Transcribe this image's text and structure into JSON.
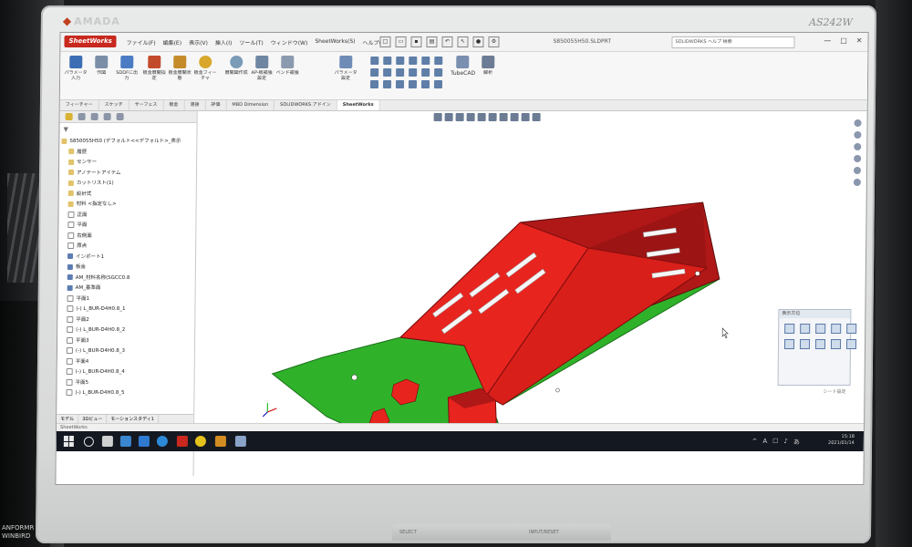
{
  "monitor": {
    "brand": "AMADA",
    "model": "AS242W",
    "osd_buttons": [
      "SELECT",
      "INPUT/RESET"
    ]
  },
  "side_device_label": "ANFORMR\nWINBIRD",
  "app": {
    "logo": "SheetWorks",
    "menus": [
      "ファイル(F)",
      "編集(E)",
      "表示(V)",
      "挿入(I)",
      "ツール(T)",
      "ウィンドウ(W)",
      "SheetWorks(S)",
      "ヘルプ(H)"
    ],
    "filename": "S850055H50.SLDPRT",
    "search_placeholder": "SOLIDWORKS ヘルプ 検索",
    "window_controls": [
      "—",
      "□",
      "✕"
    ]
  },
  "ribbon": {
    "buttons": [
      {
        "label": "パラメータ入力",
        "color": "#3b6db4"
      },
      {
        "label": "作図",
        "color": "#7b8ea7"
      },
      {
        "label": "SDDFに出力",
        "color": "#4c7cc4"
      },
      {
        "label": "板金展開指定",
        "color": "#c34b2d"
      },
      {
        "label": "板金展開状態",
        "color": "#c58b2b"
      },
      {
        "label": "板金フィーチャ",
        "color": "#d8a72c"
      },
      {
        "label": "展開図作成",
        "color": "#7b9bb7"
      },
      {
        "label": "AP-板補強設定",
        "color": "#6f86a3"
      },
      {
        "label": "ベンド補強",
        "color": "#8c9ab0"
      }
    ],
    "extras": [
      {
        "label": "パラメータ設定",
        "color": "#6f8cb7"
      },
      {
        "label": "TubeCAD",
        "color": "#7a8fb0"
      },
      {
        "label": "解析",
        "color": "#6b7c94"
      }
    ]
  },
  "tabs": [
    "フィーチャー",
    "スケッチ",
    "サーフェス",
    "板金",
    "溶接",
    "評価",
    "MBD Dimension",
    "SOLIDWORKS アドイン",
    "SheetWorks"
  ],
  "active_tab": "SheetWorks",
  "tree": {
    "filter_icon": "filter-icon",
    "root": "S850055H50 (デフォルト<<デフォルト>_表示",
    "items": [
      {
        "label": "履歴",
        "icon": "folder"
      },
      {
        "label": "センサー",
        "icon": "folder"
      },
      {
        "label": "アノテートアイテム",
        "icon": "folder"
      },
      {
        "label": "カットリスト(1)",
        "icon": "folder"
      },
      {
        "label": "設計式",
        "icon": "folder"
      },
      {
        "label": "材料 <指定なし>",
        "icon": "folder"
      },
      {
        "label": "正面",
        "icon": "plane"
      },
      {
        "label": "平面",
        "icon": "plane"
      },
      {
        "label": "右側面",
        "icon": "plane"
      },
      {
        "label": "原点",
        "icon": "plane"
      },
      {
        "label": "インポート1",
        "icon": "sheet"
      },
      {
        "label": "板金",
        "icon": "sheet"
      },
      {
        "label": "AM_材料名称(SGCC0.8",
        "icon": "sheet"
      },
      {
        "label": "AM_基準面",
        "icon": "sheet"
      },
      {
        "label": "平面1",
        "icon": "plane"
      },
      {
        "label": "(-) L_BUR-D4H0.8_1",
        "icon": "plane"
      },
      {
        "label": "平面2",
        "icon": "plane"
      },
      {
        "label": "(-) L_BUR-D4H0.8_2",
        "icon": "plane"
      },
      {
        "label": "平面3",
        "icon": "plane"
      },
      {
        "label": "(-) L_BUR-D4H0.8_3",
        "icon": "plane"
      },
      {
        "label": "平面4",
        "icon": "plane"
      },
      {
        "label": "(-) L_BUR-D4H0.8_4",
        "icon": "plane"
      },
      {
        "label": "平面5",
        "icon": "plane"
      },
      {
        "label": "(-) L_BUR-D4H0.8_5",
        "icon": "plane"
      }
    ],
    "bottom_tabs": [
      "モデル",
      "3Dビュー",
      "モーションスタディ1"
    ]
  },
  "status_bar": "SheetWorks",
  "taskpane": {
    "title": "表示方位",
    "view_label": "シート設定"
  },
  "model_colors": {
    "red": "#e8241f",
    "dark_red": "#b01818",
    "green": "#2fb22a",
    "light_green": "#53cc3d"
  },
  "taskbar": {
    "tray_time": "15:18",
    "tray_date": "2021/01/14",
    "tray_icons": [
      "^",
      "A",
      "☐",
      "♪",
      "あ"
    ],
    "pinned": [
      {
        "name": "windows-start-icon"
      },
      {
        "name": "search-icon",
        "color": "#e0e0e0"
      },
      {
        "name": "task-view-icon",
        "color": "#d0d0d0"
      },
      {
        "name": "store-icon",
        "color": "#3a86d0"
      },
      {
        "name": "mail-icon",
        "color": "#2f7ad0"
      },
      {
        "name": "edge-icon",
        "color": "#2d8ad8"
      },
      {
        "name": "solidworks-icon",
        "color": "#c8281e"
      },
      {
        "name": "chrome-icon",
        "color": "#e4c21c"
      },
      {
        "name": "tool-icon",
        "color": "#d38c22"
      },
      {
        "name": "viewer-icon",
        "color": "#8aa3c8"
      }
    ]
  }
}
